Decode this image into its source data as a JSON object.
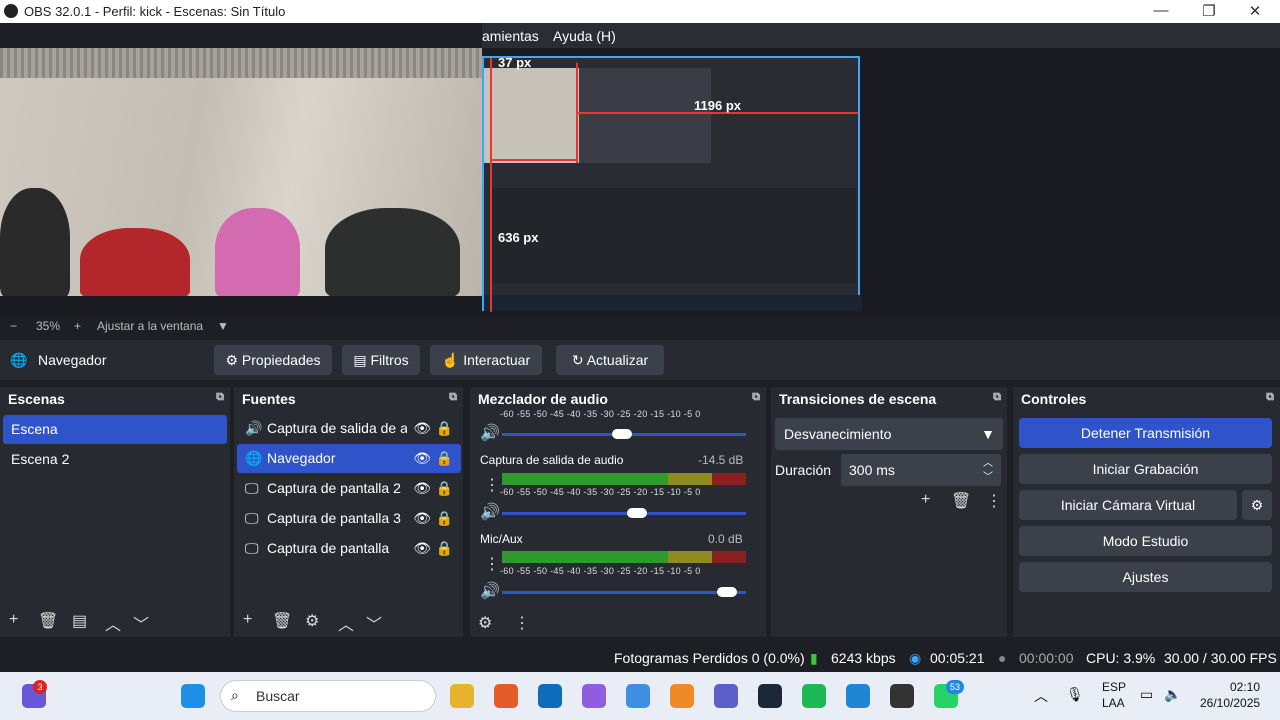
{
  "window": {
    "title": "OBS 32.0.1 - Perfil: kick - Escenas: Sin Título"
  },
  "menu": {
    "partial_item": "amientas",
    "help": "Ayuda (H)"
  },
  "preview": {
    "label_width": "1196 px",
    "label_top": "37 px",
    "label_height": "636 px"
  },
  "zoom": {
    "minus": "−",
    "percent": "35%",
    "plus": "+",
    "fit": "Ajustar a la ventana"
  },
  "source_toolbar": {
    "name": "Navegador",
    "properties": "Propiedades",
    "filters": "Filtros",
    "interact": "Interactuar",
    "refresh": "Actualizar"
  },
  "scenes": {
    "title": "Escenas",
    "items": [
      "Escena",
      "Escena 2"
    ]
  },
  "sources": {
    "title": "Fuentes",
    "items": [
      "Captura de salida de audio",
      "Navegador",
      "Captura de pantalla 2",
      "Captura de pantalla 3",
      "Captura de pantalla"
    ]
  },
  "mixer": {
    "title": "Mezclador de audio",
    "scale": "-60 -55 -50 -45 -40 -35 -30 -25 -20 -15 -10 -5 0",
    "channels": [
      {
        "name": "Captura de salida de audio",
        "db": "-14.5 dB",
        "volume": 0.56
      },
      {
        "name": "Mic/Aux",
        "db": "0.0 dB",
        "volume": 0.96
      }
    ],
    "top_channel_volume": 0.49
  },
  "transitions": {
    "title": "Transiciones de escena",
    "selected": "Desvanecimiento",
    "duration_label": "Duración",
    "duration_value": "300 ms"
  },
  "controls": {
    "title": "Controles",
    "stop_stream": "Detener Transmisión",
    "start_record": "Iniciar Grabación",
    "virtual_cam": "Iniciar Cámara Virtual",
    "studio": "Modo Estudio",
    "settings": "Ajustes"
  },
  "status": {
    "dropped": "Fotogramas Perdidos 0 (0.0%)",
    "bitrate": "6243 kbps",
    "stream_time": "00:05:21",
    "rec_time": "00:00:00",
    "cpu": "CPU: 3.9%",
    "fps": "30.00 / 30.00 FPS"
  },
  "taskbar": {
    "search": "Buscar",
    "lang1": "ESP",
    "lang2": "LAA",
    "time": "02:10",
    "date": "26/10/2025",
    "badge1": "3",
    "badge2": "53"
  },
  "colors": {
    "accent": "#2f54c9",
    "selection": "#3ea6ff"
  }
}
